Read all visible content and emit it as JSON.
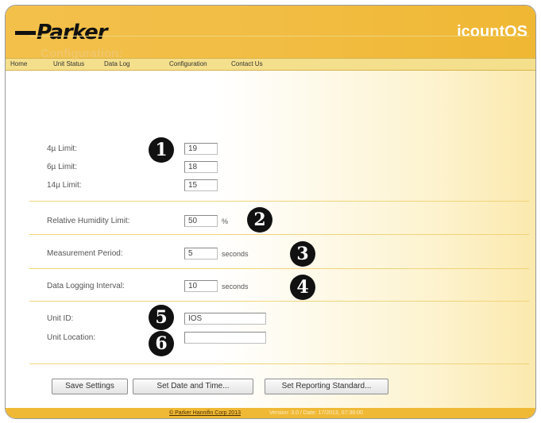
{
  "header": {
    "logo_text": "Parker",
    "app_name": "icountOS"
  },
  "nav": [
    "Home",
    "Unit Status",
    "Data Log",
    "Configuration",
    "Contact Us"
  ],
  "page": {
    "title": "Configuration:"
  },
  "limits": [
    {
      "label": "4µ Limit:",
      "value": "19"
    },
    {
      "label": "6µ Limit:",
      "value": "18"
    },
    {
      "label": "14µ Limit:",
      "value": "15"
    }
  ],
  "humidity": {
    "label": "Relative Humidity Limit:",
    "value": "50",
    "unit": "%"
  },
  "measurement": {
    "label": "Measurement Period:",
    "value": "5",
    "unit": "seconds"
  },
  "logging": {
    "label": "Data Logging Interval:",
    "value": "10",
    "unit": "seconds"
  },
  "unit_id": {
    "label": "Unit ID:",
    "value": "IOS"
  },
  "unit_location": {
    "label": "Unit Location:",
    "value": ""
  },
  "callouts": [
    "1",
    "2",
    "3",
    "4",
    "5",
    "6"
  ],
  "buttons": {
    "save": "Save Settings",
    "date_time": "Set Date and Time...",
    "reporting": "Set Reporting Standard..."
  },
  "footer": {
    "copyright": "© Parker Hannifin Corp 2013",
    "version": "Version: 3.0 / Date: 17/2013, 07:38:00"
  }
}
